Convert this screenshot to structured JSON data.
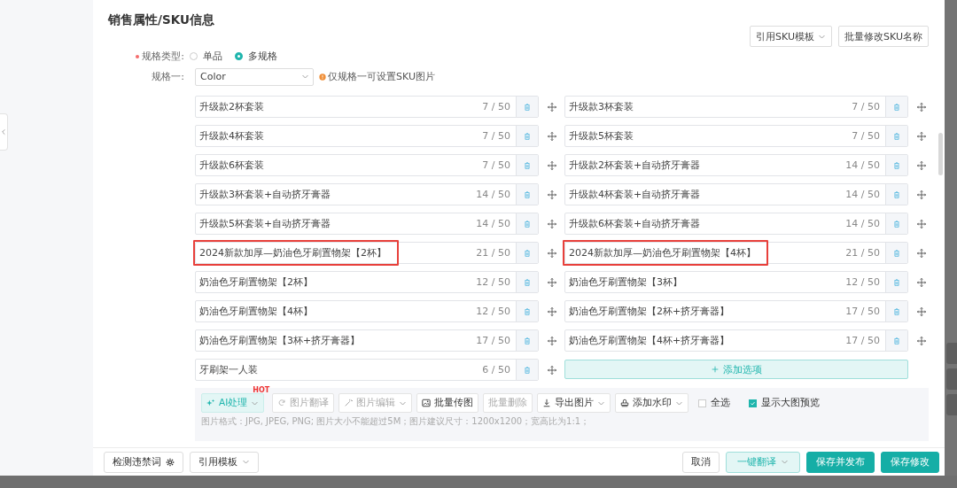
{
  "section_title": "销售属性/SKU信息",
  "top_actions": [
    {
      "label": "引用SKU模板",
      "caret": true
    },
    {
      "label": "批量修改SKU名称",
      "caret": false
    }
  ],
  "spec_type": {
    "label": "规格类型:",
    "required": true,
    "options": [
      {
        "label": "单品",
        "selected": false
      },
      {
        "label": "多规格",
        "selected": true
      }
    ]
  },
  "spec_one": {
    "label": "规格一:",
    "value": "Color",
    "hint": "仅规格一可设置SKU图片"
  },
  "options": [
    {
      "value": "升级款2杯套装",
      "count": "7 / 50",
      "highlighted": false
    },
    {
      "value": "升级款3杯套装",
      "count": "7 / 50",
      "highlighted": false
    },
    {
      "value": "升级款4杯套装",
      "count": "7 / 50",
      "highlighted": false
    },
    {
      "value": "升级款5杯套装",
      "count": "7 / 50",
      "highlighted": false
    },
    {
      "value": "升级款6杯套装",
      "count": "7 / 50",
      "highlighted": false
    },
    {
      "value": "升级款2杯套装+自动挤牙膏器",
      "count": "14 / 50",
      "highlighted": false
    },
    {
      "value": "升级款3杯套装+自动挤牙膏器",
      "count": "14 / 50",
      "highlighted": false
    },
    {
      "value": "升级款4杯套装+自动挤牙膏器",
      "count": "14 / 50",
      "highlighted": false
    },
    {
      "value": "升级款5杯套装+自动挤牙膏器",
      "count": "14 / 50",
      "highlighted": false
    },
    {
      "value": "升级款6杯套装+自动挤牙膏器",
      "count": "14 / 50",
      "highlighted": false
    },
    {
      "value": "2024新款加厚—奶油色牙刷置物架【2杯】",
      "count": "21 / 50",
      "highlighted": true
    },
    {
      "value": "2024新款加厚—奶油色牙刷置物架【4杯】",
      "count": "21 / 50",
      "highlighted": true
    },
    {
      "value": "奶油色牙刷置物架【2杯】",
      "count": "12 / 50",
      "highlighted": false
    },
    {
      "value": "奶油色牙刷置物架【3杯】",
      "count": "12 / 50",
      "highlighted": false
    },
    {
      "value": "奶油色牙刷置物架【4杯】",
      "count": "12 / 50",
      "highlighted": false
    },
    {
      "value": "奶油色牙刷置物架【2杯+挤牙膏器】",
      "count": "17 / 50",
      "highlighted": false
    },
    {
      "value": "奶油色牙刷置物架【3杯+挤牙膏器】",
      "count": "17 / 50",
      "highlighted": false
    },
    {
      "value": "奶油色牙刷置物架【4杯+挤牙膏器】",
      "count": "17 / 50",
      "highlighted": false
    },
    {
      "value": "牙刷架一人装",
      "count": "6 / 50",
      "highlighted": false
    }
  ],
  "add_option": {
    "label": "添加选项"
  },
  "image_toolbar": {
    "buttons": [
      {
        "label": "AI处理",
        "kind": "ai",
        "caret": true,
        "badge": "HOT",
        "disabled": false
      },
      {
        "label": "图片翻译",
        "kind": "plain",
        "caret": false,
        "disabled": true
      },
      {
        "label": "图片编辑",
        "kind": "plain",
        "caret": true,
        "disabled": true
      },
      {
        "label": "批量传图",
        "kind": "plain",
        "caret": false,
        "disabled": false
      },
      {
        "label": "批量删除",
        "kind": "plain",
        "caret": false,
        "disabled": true
      },
      {
        "label": "导出图片",
        "kind": "plain",
        "caret": true,
        "disabled": false
      },
      {
        "label": "添加水印",
        "kind": "plain",
        "caret": true,
        "disabled": false
      }
    ],
    "checkboxes": [
      {
        "label": "全选",
        "checked": false
      },
      {
        "label": "显示大图预览",
        "checked": true
      }
    ],
    "note": "图片格式：JPG, JPEG, PNG; 图片大小不能超过5M；图片建议尺寸：1200x1200；宽高比为1:1；"
  },
  "footer": {
    "left": [
      {
        "label": "检测违禁词",
        "kind": "default",
        "caret": false
      },
      {
        "label": "引用模板",
        "kind": "default",
        "caret": true
      }
    ],
    "right": [
      {
        "label": "取消",
        "kind": "default",
        "caret": false
      },
      {
        "label": "一键翻译",
        "kind": "light",
        "caret": true
      },
      {
        "label": "保存并发布",
        "kind": "primary",
        "caret": false
      },
      {
        "label": "保存修改",
        "kind": "primary",
        "caret": false
      }
    ]
  }
}
